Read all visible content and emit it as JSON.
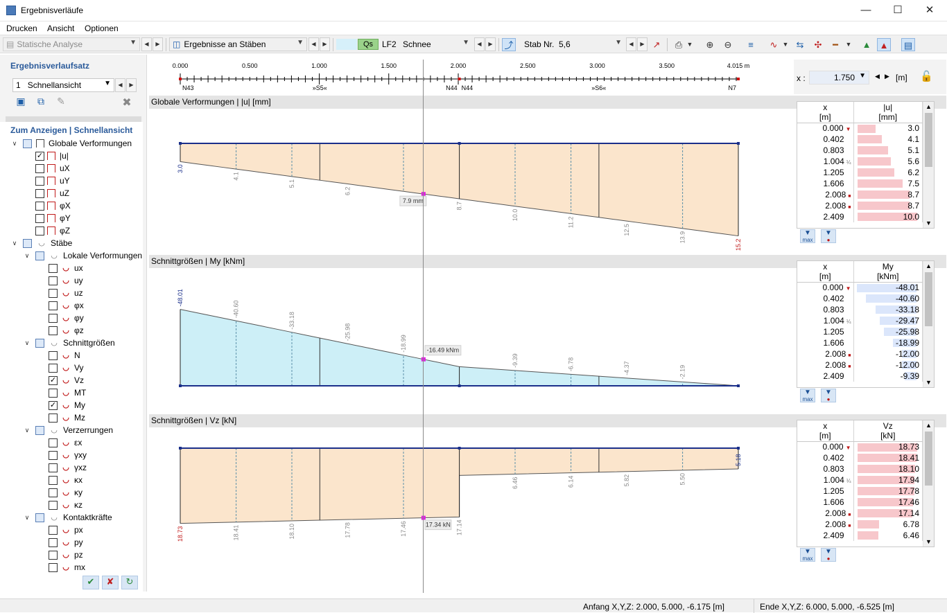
{
  "window": {
    "title": "Ergebnisverläufe"
  },
  "menu": [
    "Drucken",
    "Ansicht",
    "Optionen"
  ],
  "toolbar": {
    "analysis": "Statische Analyse",
    "results_on": "Ergebnisse an Stäben",
    "lc_tag": "Qs",
    "lc_name": "LF2",
    "lc_desc": "Schnee",
    "stab_label": "Stab Nr.",
    "stab_value": "5,6"
  },
  "left": {
    "set_title": "Ergebnisverlaufsatz",
    "set_num": "1",
    "set_name": "Schnellansicht",
    "display_title": "Zum Anzeigen | Schnellansicht",
    "tree": [
      {
        "label": "Globale Verformungen",
        "level": 0,
        "kind": "group"
      },
      {
        "label": "|u|",
        "level": 1,
        "kind": "glob",
        "checked": true
      },
      {
        "label": "uX",
        "level": 1,
        "kind": "glob",
        "checked": false
      },
      {
        "label": "uY",
        "level": 1,
        "kind": "glob",
        "checked": false
      },
      {
        "label": "uZ",
        "level": 1,
        "kind": "glob",
        "checked": false
      },
      {
        "label": "φX",
        "level": 1,
        "kind": "glob",
        "checked": false
      },
      {
        "label": "φY",
        "level": 1,
        "kind": "glob",
        "checked": false
      },
      {
        "label": "φZ",
        "level": 1,
        "kind": "glob",
        "checked": false
      },
      {
        "label": "Stäbe",
        "level": 0,
        "kind": "group"
      },
      {
        "label": "Lokale Verformungen",
        "level": 1,
        "kind": "group"
      },
      {
        "label": "ux",
        "level": 2,
        "kind": "red",
        "checked": false
      },
      {
        "label": "uy",
        "level": 2,
        "kind": "red",
        "checked": false
      },
      {
        "label": "uz",
        "level": 2,
        "kind": "red",
        "checked": false
      },
      {
        "label": "φx",
        "level": 2,
        "kind": "red",
        "checked": false
      },
      {
        "label": "φy",
        "level": 2,
        "kind": "red",
        "checked": false
      },
      {
        "label": "φz",
        "level": 2,
        "kind": "red",
        "checked": false
      },
      {
        "label": "Schnittgrößen",
        "level": 1,
        "kind": "group"
      },
      {
        "label": "N",
        "level": 2,
        "kind": "red",
        "checked": false
      },
      {
        "label": "Vy",
        "level": 2,
        "kind": "red",
        "checked": false
      },
      {
        "label": "Vz",
        "level": 2,
        "kind": "red",
        "checked": true
      },
      {
        "label": "MT",
        "level": 2,
        "kind": "red",
        "checked": false
      },
      {
        "label": "My",
        "level": 2,
        "kind": "red",
        "checked": true
      },
      {
        "label": "Mz",
        "level": 2,
        "kind": "red",
        "checked": false
      },
      {
        "label": "Verzerrungen",
        "level": 1,
        "kind": "group"
      },
      {
        "label": "εx",
        "level": 2,
        "kind": "red",
        "checked": false
      },
      {
        "label": "γxy",
        "level": 2,
        "kind": "red",
        "checked": false
      },
      {
        "label": "γxz",
        "level": 2,
        "kind": "red",
        "checked": false
      },
      {
        "label": "κx",
        "level": 2,
        "kind": "red",
        "checked": false
      },
      {
        "label": "κy",
        "level": 2,
        "kind": "red",
        "checked": false
      },
      {
        "label": "κz",
        "level": 2,
        "kind": "red",
        "checked": false
      },
      {
        "label": "Kontaktkräfte",
        "level": 1,
        "kind": "group"
      },
      {
        "label": "px",
        "level": 2,
        "kind": "red",
        "checked": false
      },
      {
        "label": "py",
        "level": 2,
        "kind": "red",
        "checked": false
      },
      {
        "label": "pz",
        "level": 2,
        "kind": "red",
        "checked": false
      },
      {
        "label": "mx",
        "level": 2,
        "kind": "red",
        "checked": false
      }
    ]
  },
  "ruler": {
    "ticks": [
      "0.000",
      "0.500",
      "1.000",
      "1.500",
      "2.000",
      "2.500",
      "3.000",
      "3.500",
      "4.015 m"
    ],
    "nodes": [
      "N43",
      "»S5«",
      "N44",
      "N44",
      "»S6«",
      "N7"
    ],
    "x_label": "x :",
    "x_value": "1.750",
    "x_unit": "[m]"
  },
  "charts": [
    {
      "header": "Globale Verformungen | |u| [mm]",
      "col_x": "x",
      "col_x_unit": "[m]",
      "col_v": "|u|",
      "col_v_unit": "[mm]",
      "rows": [
        {
          "x": "0.000",
          "v": "3.0"
        },
        {
          "x": "0.402",
          "v": "4.1"
        },
        {
          "x": "0.803",
          "v": "5.1"
        },
        {
          "x": "1.004",
          "v": "5.6"
        },
        {
          "x": "1.205",
          "v": "6.2"
        },
        {
          "x": "1.606",
          "v": "7.5"
        },
        {
          "x": "2.008",
          "v": "8.7"
        },
        {
          "x": "2.008",
          "v": "8.7"
        },
        {
          "x": "2.409",
          "v": "10.0"
        }
      ],
      "labels": [
        "3.0",
        "4.1",
        "5.1",
        "6.2",
        "8.7",
        "10.0",
        "11.2",
        "12.5",
        "13.9",
        "15.2"
      ],
      "cursor": "7.9 mm"
    },
    {
      "header": "Schnittgrößen | My [kNm]",
      "col_x": "x",
      "col_x_unit": "[m]",
      "col_v": "My",
      "col_v_unit": "[kNm]",
      "rows": [
        {
          "x": "0.000",
          "v": "-48.01"
        },
        {
          "x": "0.402",
          "v": "-40.60"
        },
        {
          "x": "0.803",
          "v": "-33.18"
        },
        {
          "x": "1.004",
          "v": "-29.47"
        },
        {
          "x": "1.205",
          "v": "-25.98"
        },
        {
          "x": "1.606",
          "v": "-18.99"
        },
        {
          "x": "2.008",
          "v": "-12.00"
        },
        {
          "x": "2.008",
          "v": "-12.00"
        },
        {
          "x": "2.409",
          "v": "-9.39"
        }
      ],
      "labels": [
        "-48.01",
        "-40.60",
        "-33.18",
        "-25.98",
        "-18.99",
        "-9.39",
        "-6.78",
        "-4.37",
        "-2.19"
      ],
      "cursor": "-16.49 kNm"
    },
    {
      "header": "Schnittgrößen | Vz [kN]",
      "col_x": "x",
      "col_x_unit": "[m]",
      "col_v": "Vz",
      "col_v_unit": "[kN]",
      "rows": [
        {
          "x": "0.000",
          "v": "18.73"
        },
        {
          "x": "0.402",
          "v": "18.41"
        },
        {
          "x": "0.803",
          "v": "18.10"
        },
        {
          "x": "1.004",
          "v": "17.94"
        },
        {
          "x": "1.205",
          "v": "17.78"
        },
        {
          "x": "1.606",
          "v": "17.46"
        },
        {
          "x": "2.008",
          "v": "17.14"
        },
        {
          "x": "2.008",
          "v": "6.78"
        },
        {
          "x": "2.409",
          "v": "6.46"
        }
      ],
      "labels": [
        "18.73",
        "18.41",
        "18.10",
        "17.78",
        "17.46",
        "17.14",
        "6.46",
        "6.14",
        "5.82",
        "5.50",
        "5.18"
      ],
      "cursor": "17.34 kN"
    }
  ],
  "filter_max": "max",
  "status": {
    "start": "Anfang X,Y,Z: 2.000, 5.000, -6.175 [m]",
    "end": "Ende X,Y,Z: 6.000, 5.000, -6.525 [m]"
  }
}
